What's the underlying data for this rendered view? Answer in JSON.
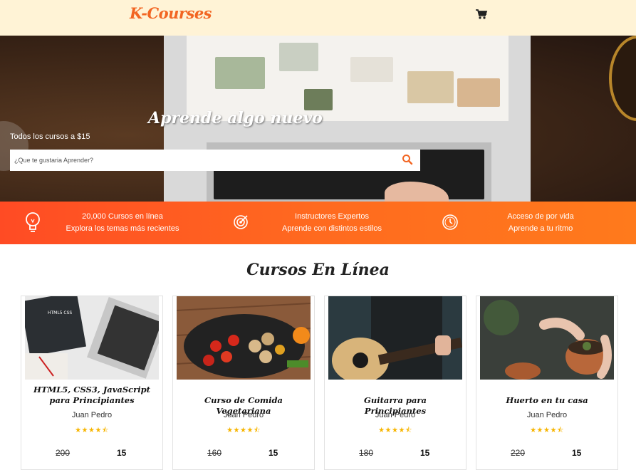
{
  "header": {
    "logo": "K-Courses",
    "cart_icon": "cart-icon"
  },
  "hero": {
    "title": "Aprende algo nuevo",
    "subtitle": "Todos los cursos a $15",
    "search_placeholder": "¿Que te gustaria Aprender?",
    "search_icon": "search-icon"
  },
  "features": [
    {
      "icon": "lightbulb-icon",
      "line1": "20,000 Cursos en línea",
      "line2": "Explora los temas más recientes"
    },
    {
      "icon": "target-icon",
      "line1": "Instructores Expertos",
      "line2": "Aprende con distintos estilos"
    },
    {
      "icon": "clock-icon",
      "line1": "Acceso de por vida",
      "line2": "Aprende a tu ritmo"
    }
  ],
  "section": {
    "title": "Cursos En Línea"
  },
  "courses": [
    {
      "title": "HTML5, CSS3, JavaScript para Principiantes",
      "author": "Juan Pedro",
      "rating": 4.5,
      "old_price": "200",
      "price": "15",
      "image": "html-book-laptop"
    },
    {
      "title": "Curso de Comida Vegetariana",
      "author": "Juan Pedro",
      "rating": 4.5,
      "old_price": "160",
      "price": "15",
      "image": "vegetables-pan"
    },
    {
      "title": "Guitarra para Principiantes",
      "author": "Juan Pedro",
      "rating": 4.5,
      "old_price": "180",
      "price": "15",
      "image": "guitar-player"
    },
    {
      "title": "Huerto en tu casa",
      "author": "Juan Pedro",
      "rating": 4.5,
      "old_price": "220",
      "price": "15",
      "image": "hands-plant-pot"
    }
  ],
  "colors": {
    "accent": "#f26522",
    "header_bg": "#fff3d6",
    "band_start": "#ff4b24",
    "band_end": "#ff7a1c",
    "stars": "#f7b500"
  }
}
